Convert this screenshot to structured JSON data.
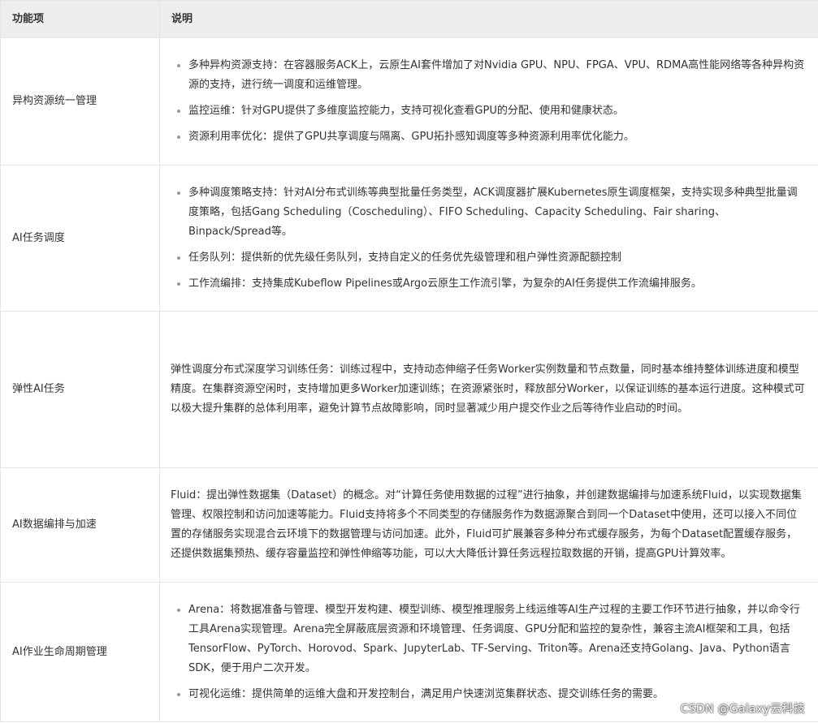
{
  "header": {
    "col1": "功能项",
    "col2": "说明"
  },
  "rows": [
    {
      "name": "异构资源统一管理",
      "items": [
        "多种异构资源支持：在容器服务ACK上，云原生AI套件增加了对Nvidia GPU、NPU、FPGA、VPU、RDMA高性能网络等各种异构资源的支持，进行统一调度和运维管理。",
        "监控运维：针对GPU提供了多维度监控能力，支持可视化查看GPU的分配、使用和健康状态。",
        "资源利用率优化：提供了GPU共享调度与隔离、GPU拓扑感知调度等多种资源利用率优化能力。"
      ]
    },
    {
      "name": "AI任务调度",
      "items": [
        "多种调度策略支持：针对AI分布式训练等典型批量任务类型，ACK调度器扩展Kubernetes原生调度框架，支持实现多种典型批量调度策略，包括Gang Scheduling（Coscheduling）、FIFO Scheduling、Capacity Scheduling、Fair sharing、Binpack/Spread等。",
        "任务队列：提供新的优先级任务队列，支持自定义的任务优先级管理和租户弹性资源配额控制",
        "工作流编排：支持集成Kubeflow Pipelines或Argo云原生工作流引擎，为复杂的AI任务提供工作流编排服务。"
      ]
    },
    {
      "name": "弹性AI任务",
      "text": "弹性调度分布式深度学习训练任务：训练过程中，支持动态伸缩子任务Worker实例数量和节点数量，同时基本维持整体训练进度和模型精度。在集群资源空闲时，支持增加更多Worker加速训练；在资源紧张时，释放部分Worker，以保证训练的基本运行进度。这种模式可以极大提升集群的总体利用率，避免计算节点故障影响，同时显著减少用户提交作业之后等待作业启动的时间。"
    },
    {
      "name": "AI数据编排与加速",
      "text": "Fluid：提出弹性数据集（Dataset）的概念。对“计算任务使用数据的过程”进行抽象，并创建数据编排与加速系统Fluid，以实现数据集管理、权限控制和访问加速等能力。Fluid支持将多个不同类型的存储服务作为数据源聚合到同一个Dataset中使用，还可以接入不同位置的存储服务实现混合云环境下的数据管理与访问加速。此外，Fluid可扩展兼容多种分布式缓存服务，为每个Dataset配置缓存服务，还提供数据集预热、缓存容量监控和弹性伸缩等功能，可以大大降低计算任务远程拉取数据的开销，提高GPU计算效率。"
    },
    {
      "name": "AI作业生命周期管理",
      "items": [
        "Arena：将数据准备与管理、模型开发构建、模型训练、模型推理服务上线运维等AI生产过程的主要工作环节进行抽象，并以命令行工具Arena实现管理。Arena完全屏蔽底层资源和环境管理、任务调度、GPU分配和监控的复杂性，兼容主流AI框架和工具，包括TensorFlow、PyTorch、Horovod、Spark、JupyterLab、TF-Serving、Triton等。Arena还支持Golang、Java、Python语言SDK，便于用户二次开发。",
        "可视化运维：提供简单的运维大盘和开发控制台，满足用户快速浏览集群状态、提交训练任务的需要。"
      ]
    }
  ],
  "watermark": "CSDN @Galaxy云科技"
}
